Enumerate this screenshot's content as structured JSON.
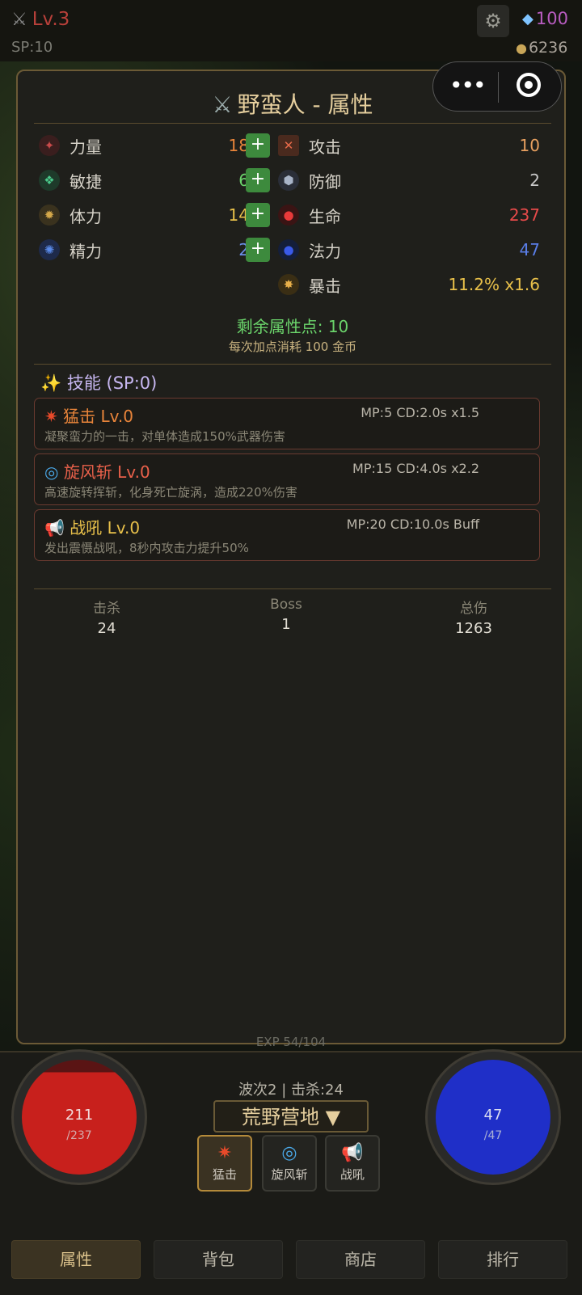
{
  "topbar": {
    "level": "Lv.3",
    "sp": "SP:10",
    "gems": "100",
    "gold": "6236"
  },
  "panel": {
    "title": "野蛮人 - 属性",
    "close_label": "X",
    "stats_left": [
      {
        "name": "力量",
        "value": "18",
        "icon": "strength-icon",
        "color": "#e8843a"
      },
      {
        "name": "敏捷",
        "value": "6",
        "icon": "agility-icon",
        "color": "#6bd46b"
      },
      {
        "name": "体力",
        "value": "14",
        "icon": "stamina-icon",
        "color": "#e8c04a"
      },
      {
        "name": "精力",
        "value": "2",
        "icon": "energy-icon",
        "color": "#6a8ee8"
      }
    ],
    "plus_label": "+",
    "stats_right": [
      {
        "name": "攻击",
        "value": "10",
        "icon": "attack-icon",
        "color": "#e8a060"
      },
      {
        "name": "防御",
        "value": "2",
        "icon": "defense-icon",
        "color": "#c8c8c8"
      },
      {
        "name": "生命",
        "value": "237",
        "icon": "life-icon",
        "color": "#e84a4a"
      },
      {
        "name": "法力",
        "value": "47",
        "icon": "mana-icon",
        "color": "#5a7ee8"
      },
      {
        "name": "暴击",
        "value": "11.2%  x1.6",
        "icon": "crit-icon",
        "color": "#e8c04a"
      }
    ],
    "remaining_points": "剩余属性点: 10",
    "cost_note": "每次加点消耗 100 金币"
  },
  "skills": {
    "title": "技能 (SP:0)",
    "items": [
      {
        "name": "猛击 Lv.0",
        "stats": "MP:5 CD:2.0s x1.5",
        "desc": "凝聚蛮力的一击，对单体造成150%武器伤害",
        "color": "#e8843a",
        "icon": "bash-icon"
      },
      {
        "name": "旋风斩 Lv.0",
        "stats": "MP:15 CD:4.0s x2.2",
        "desc": "高速旋转挥斩，化身死亡旋涡，造成220%伤害",
        "color": "#e8604a",
        "icon": "whirlwind-icon"
      },
      {
        "name": "战吼 Lv.0",
        "stats": "MP:20 CD:10.0s Buff",
        "desc": "发出震慑战吼，8秒内攻击力提升50%",
        "color": "#e8c04a",
        "icon": "warcry-icon"
      }
    ]
  },
  "summary": [
    {
      "label": "击杀",
      "value": "24"
    },
    {
      "label": "Boss",
      "value": "1"
    },
    {
      "label": "总伤",
      "value": "1263"
    }
  ],
  "hud": {
    "exp": "EXP 54/104",
    "hp_current": "211",
    "hp_max": "/237",
    "hp_fraction": 0.89,
    "mp_current": "47",
    "mp_max": "/47",
    "mp_fraction": 1.0,
    "wave": "波次2 | 击杀:24",
    "map": "荒野营地 ▼",
    "skill_slots": [
      "猛击",
      "旋风斩",
      "战吼"
    ]
  },
  "tabs": [
    "属性",
    "背包",
    "商店",
    "排行"
  ],
  "colors": {
    "accent_gold": "#e6cf9e",
    "hp_red": "#c8201c",
    "mp_blue": "#1f2fc8",
    "plus_green": "#3d8a3d"
  }
}
